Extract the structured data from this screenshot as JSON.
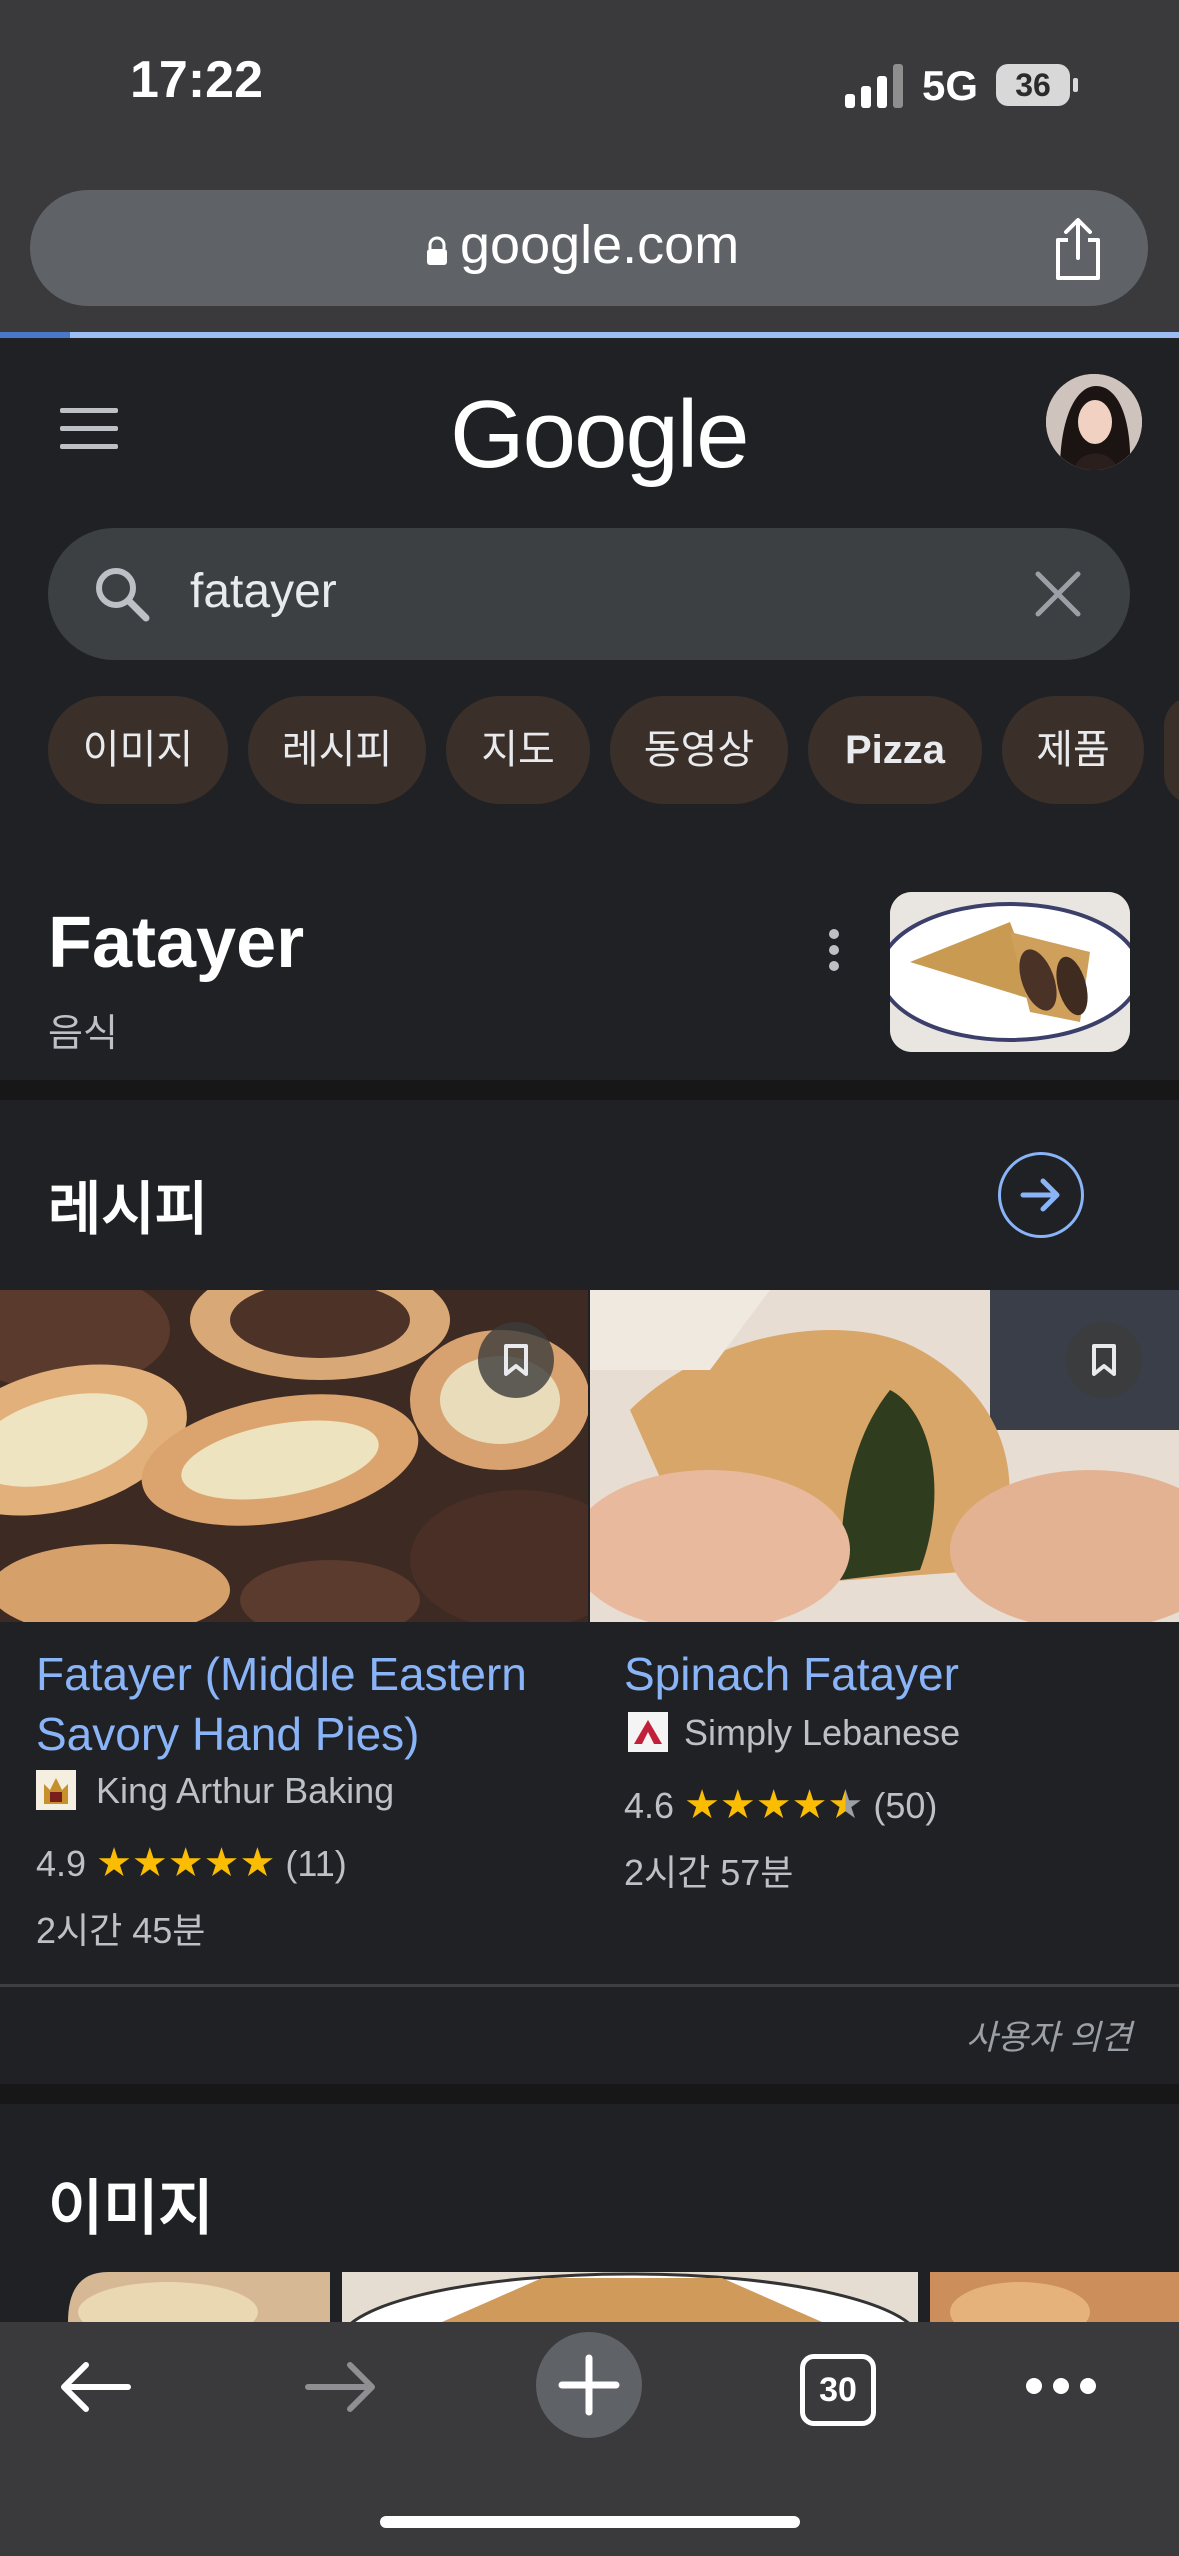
{
  "status_bar": {
    "time": "17:22",
    "network": "5G",
    "battery": "36"
  },
  "browser": {
    "url": "google.com",
    "tab_count": "30"
  },
  "header": {
    "logo": "Google"
  },
  "search": {
    "query": "fatayer"
  },
  "chips": [
    "이미지",
    "레시피",
    "지도",
    "동영상",
    "Pizza",
    "제품"
  ],
  "knowledge_panel": {
    "title": "Fatayer",
    "subtitle": "음식"
  },
  "recipes": {
    "section_title": "레시피",
    "items": [
      {
        "title_line1": "Fatayer (Middle Eastern",
        "title_line2": "Savory Hand Pies)",
        "source": "King Arthur Baking",
        "rating": "4.9",
        "stars": "★★★★★",
        "rating_value": 4.9,
        "reviews": "(11)",
        "time": "2시간 45분"
      },
      {
        "title_line1": "Spinach Fatayer",
        "title_line2": "",
        "source": "Simply Lebanese",
        "rating": "4.6",
        "stars": "★★★★",
        "rating_value": 4.6,
        "reviews": "(50)",
        "time": "2시간 57분"
      }
    ],
    "feedback": "사용자 의견"
  },
  "images": {
    "section_title": "이미지"
  },
  "colors": {
    "accent_link": "#8ab4f8",
    "star": "#fbbc04",
    "background": "#202124"
  }
}
